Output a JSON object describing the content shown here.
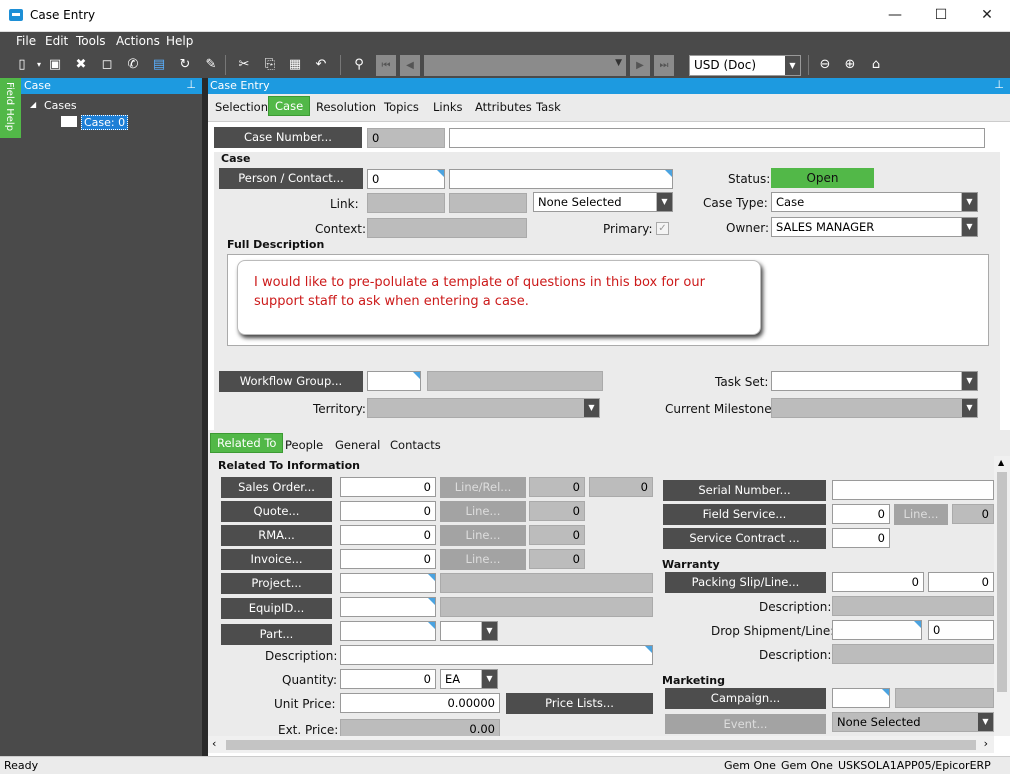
{
  "window": {
    "title": "Case Entry",
    "minimize": "—",
    "maximize": "☐",
    "close": "✕"
  },
  "menu": [
    "File",
    "Edit",
    "Tools",
    "Actions",
    "Help"
  ],
  "toolbar": {
    "currency": "USD (Doc)"
  },
  "left": {
    "field_help": "Field Help",
    "pane_title": "Case",
    "tree_root": "Cases",
    "tree_item": "Case: 0"
  },
  "main": {
    "pane_title": "Case Entry",
    "tabs": [
      "Selection",
      "Case",
      "Resolution",
      "Topics",
      "Links",
      "Attributes",
      "Task"
    ],
    "case_number_btn": "Case Number...",
    "case_number": "0",
    "section_case": "Case",
    "person_contact_btn": "Person / Contact...",
    "person_value": "0",
    "link_label": "Link:",
    "link_select": "None Selected",
    "context_label": "Context:",
    "primary_label": "Primary:",
    "status_label": "Status:",
    "status_value": "Open",
    "case_type_label": "Case Type:",
    "case_type_value": "Case",
    "owner_label": "Owner:",
    "owner_value": "SALES MANAGER",
    "full_desc_label": "Full Description",
    "callout_text": "I would like to pre-polulate a template of questions in this box for our support staff to ask when entering a case.",
    "workflow_btn": "Workflow Group...",
    "territory_label": "Territory:",
    "task_set_label": "Task Set:",
    "milestone_label": "Current Milestone:"
  },
  "related": {
    "tabs": [
      "Related To",
      "People",
      "General",
      "Contacts"
    ],
    "section": "Related To Information",
    "sales_order_btn": "Sales Order...",
    "sales_order_val": "0",
    "line_rel_btn": "Line/Rel...",
    "line_rel_a": "0",
    "line_rel_b": "0",
    "quote_btn": "Quote...",
    "quote_val": "0",
    "quote_line_btn": "Line...",
    "quote_line_val": "0",
    "rma_btn": "RMA...",
    "rma_val": "0",
    "rma_line_btn": "Line...",
    "rma_line_val": "0",
    "invoice_btn": "Invoice...",
    "invoice_val": "0",
    "invoice_line_btn": "Line...",
    "invoice_line_val": "0",
    "project_btn": "Project...",
    "equip_btn": "EquipID...",
    "part_btn": "Part...",
    "description_label": "Description:",
    "quantity_label": "Quantity:",
    "quantity_val": "0",
    "uom_val": "EA",
    "unit_price_label": "Unit Price:",
    "unit_price_val": "0.00000",
    "price_lists_btn": "Price Lists...",
    "ext_price_label": "Ext. Price:",
    "ext_price_val": "0.00",
    "serial_btn": "Serial Number...",
    "field_service_btn": "Field Service...",
    "field_service_val": "0",
    "fs_line_btn": "Line...",
    "fs_line_val": "0",
    "service_contract_btn": "Service Contract ...",
    "service_contract_val": "0",
    "warranty_section": "Warranty",
    "packing_btn": "Packing Slip/Line...",
    "packing_val_a": "0",
    "packing_val_b": "0",
    "w_desc_label": "Description:",
    "drop_ship_label": "Drop Shipment/Line:",
    "drop_ship_val": "0",
    "ds_desc_label": "Description:",
    "marketing_section": "Marketing",
    "campaign_btn": "Campaign...",
    "event_btn": "Event...",
    "event_select": "None Selected"
  },
  "status": {
    "left": "Ready",
    "company1": "Gem One",
    "company2": "Gem One",
    "server": "USKSOLA1APP05/EpicorERP"
  }
}
